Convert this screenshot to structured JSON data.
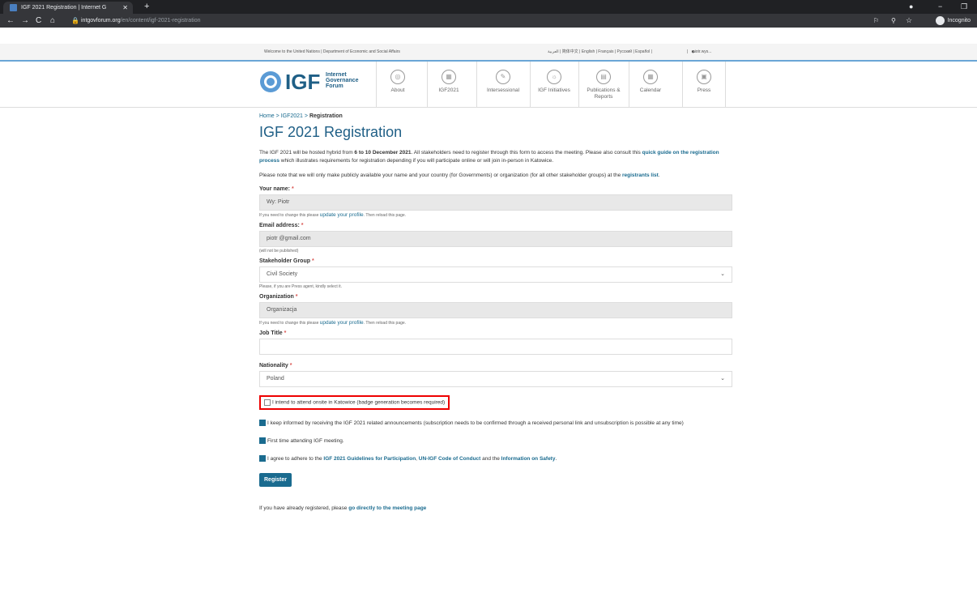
{
  "browser": {
    "tab_title": "IGF 2021 Registration | Internet G",
    "url_host": "intgovforum.org",
    "url_path": "/en/content/igf-2021-registration",
    "incognito_label": "Incognito"
  },
  "unbar": {
    "left": "Welcome to the United Nations | Department of Economic and Social Affairs",
    "languages": "العربية | 简体中文 | English | Français | Русский | Español |",
    "user": "piotr.wys..."
  },
  "header": {
    "logo_text": "IGF",
    "logo_sub1": "Internet",
    "logo_sub2": "Governance",
    "logo_sub3": "Forum",
    "menu": [
      {
        "label": "About"
      },
      {
        "label": "IGF2021"
      },
      {
        "label": "Intersessional"
      },
      {
        "label": "IGF Initiatives"
      },
      {
        "label": "Publications & Reports"
      },
      {
        "label": "Calendar"
      },
      {
        "label": "Press"
      }
    ]
  },
  "breadcrumb": {
    "home": "Home",
    "sep": ">",
    "igf": "IGF2021",
    "current": "Registration"
  },
  "page_title": "IGF 2021 Registration",
  "intro": {
    "p1_a": "The IGF 2021 will be hosted hybrid from ",
    "p1_b": "6 to 10 December 2021",
    "p1_c": ". All stakeholders need to register through this form to access the meeting. Please also consult this ",
    "p1_link": "quick guide on the registration process",
    "p1_d": " which illustrates requirements for registration depending if you will participate online or will join in-person in Katowice.",
    "p2_a": "Please note that we will only make publicly available your name and your country (for Governments) or organization (for all other stakeholder groups) at the ",
    "p2_link": "registrants list",
    "p2_b": "."
  },
  "form": {
    "name_label": "Your name:",
    "name_value": "Wy:      Piotr",
    "name_help": "If you need to change this please",
    "update_link": "update your profile",
    "reload_text": ". Then reload this page.",
    "email_label": "Email address:",
    "email_value": "piotr              @gmail.com",
    "email_help": "(will not be published)",
    "stake_label": "Stakeholder Group",
    "stake_value": "Civil Society",
    "stake_help": "Please, if you are Press agent, kindly select it.",
    "org_label": "Organization",
    "org_value": "Organizacja",
    "job_label": "Job Title",
    "job_value": "",
    "nat_label": "Nationality",
    "nat_value": "Poland",
    "onsite_label": "I intend to attend onsite in Katowice (badge generation becomes required)",
    "informed_label": "I keep informed by receiving the IGF 2021 related announcements (subscription needs to be confirmed through a received personal link and unsubscription is possible at any time)",
    "first_time_label": "First time attending IGF meeting.",
    "agree_a": "I agree to adhere to the ",
    "agree_l1": "IGF 2021 Guidelines for Participation",
    "agree_b": ", ",
    "agree_l2": "UN-IGF Code of Conduct",
    "agree_c": " and the ",
    "agree_l3": "Information on Safety",
    "agree_d": ".",
    "register": "Register",
    "already_a": "If you have already registered, please ",
    "already_link": "go directly to the meeting page"
  },
  "colors": {
    "accent": "#1a6b8f",
    "required": "#d9534f",
    "highlight": "#e00000"
  }
}
